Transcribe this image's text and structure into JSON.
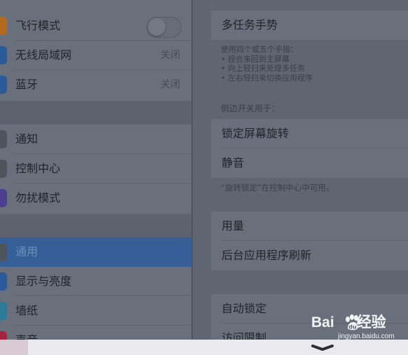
{
  "sidebar": {
    "group1": [
      {
        "label": "飞行模式",
        "type": "toggle",
        "toggle_on": false,
        "icon": "airplane-icon",
        "icon_color": "#b36a1f"
      },
      {
        "label": "无线局域网",
        "value": "关闭",
        "icon": "wifi-icon",
        "icon_color": "#2a5a99"
      },
      {
        "label": "蓝牙",
        "value": "关闭",
        "icon": "bluetooth-icon",
        "icon_color": "#2a5a99"
      }
    ],
    "group2": [
      {
        "label": "通知",
        "icon": "notifications-icon",
        "icon_color": "#4e535c"
      },
      {
        "label": "控制中心",
        "icon": "control-center-icon",
        "icon_color": "#4e535c"
      },
      {
        "label": "勿扰模式",
        "icon": "do-not-disturb-icon",
        "icon_color": "#4b3f8f"
      }
    ],
    "group3": [
      {
        "label": "通用",
        "selected": true,
        "icon": "gear-icon",
        "icon_color": "#4e535c"
      },
      {
        "label": "显示与亮度",
        "icon": "display-icon",
        "icon_color": "#2a5a99"
      },
      {
        "label": "墙纸",
        "icon": "wallpaper-icon",
        "icon_color": "#2a7a9a"
      },
      {
        "label": "声音",
        "icon": "sound-icon",
        "icon_color": "#a3243f"
      }
    ]
  },
  "detail": {
    "multitask": {
      "label": "多任务手势"
    },
    "multitask_note": [
      "使用四个或五个手指：",
      "• 捏合来回到主屏幕",
      "• 向上轻扫来处理多任务",
      "• 左右轻扫来切换应用程序"
    ],
    "side_switch_header": "侧边开关用于：",
    "side_switch_options": [
      "锁定屏幕旋转",
      "静音"
    ],
    "rotation_note": "“旋转锁定”在控制中心中可用。",
    "group_usage": [
      "用量",
      "后台应用程序刷新"
    ],
    "group_lock": [
      "自动锁定",
      "访问限制"
    ]
  },
  "watermark": {
    "brand": "Bai 经验",
    "brand_left": "Bai",
    "brand_right": "经验",
    "url": "jingyan.baidu.com"
  },
  "colors": {
    "selected": "#355f96",
    "overlay_bg": "#5f6571",
    "sheet": "#e9e9ee"
  }
}
